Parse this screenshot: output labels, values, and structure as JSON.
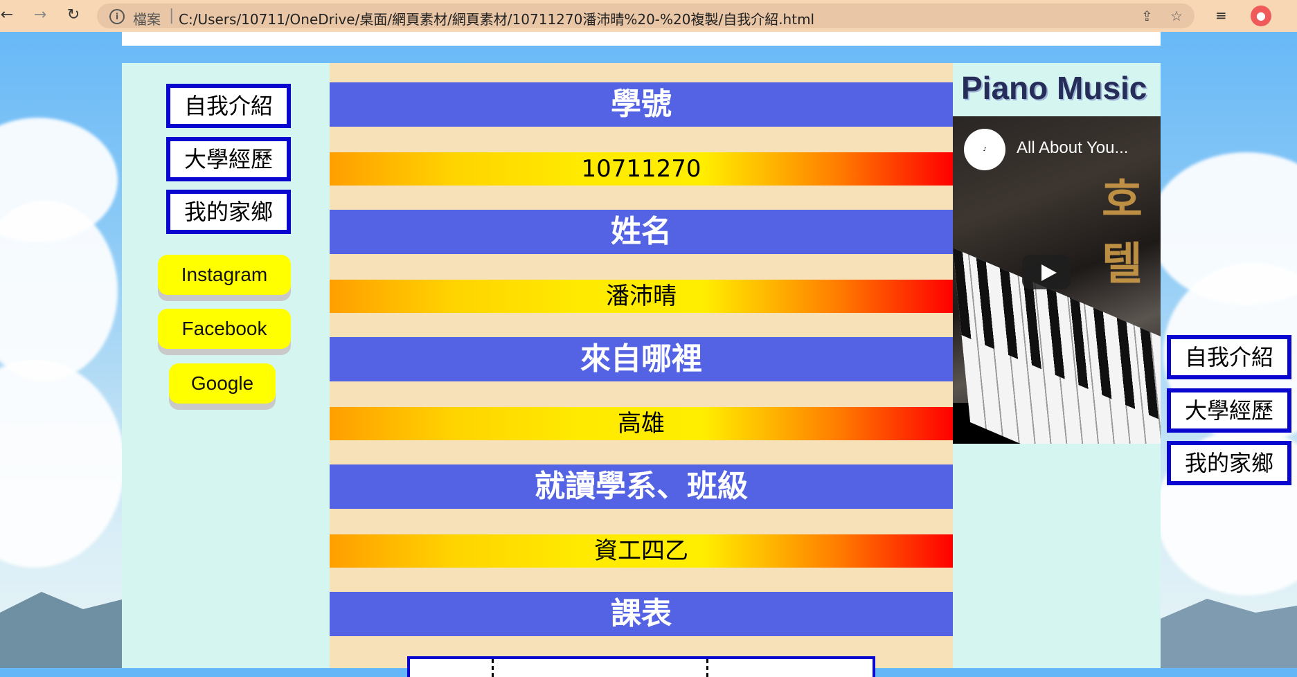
{
  "browser": {
    "address_label": "檔案",
    "url": "C:/Users/10711/OneDrive/桌面/網頁素材/網頁素材/10711270潘沛晴%20-%20複製/自我介紹.html"
  },
  "left_nav": [
    "自我介紹",
    "大學經歷",
    "我的家鄉"
  ],
  "links": [
    "Instagram",
    "Facebook",
    "Google"
  ],
  "sections": [
    {
      "heading": "學號",
      "value": "10711270"
    },
    {
      "heading": "姓名",
      "value": "潘沛晴"
    },
    {
      "heading": "來自哪裡",
      "value": "高雄"
    },
    {
      "heading": "就讀學系、班級",
      "value": "資工四乙"
    },
    {
      "heading": "課表",
      "value": ""
    }
  ],
  "sidebar": {
    "title": "Piano Music",
    "video_title": "All About You..."
  },
  "right_nav": [
    "自我介紹",
    "大學經歷",
    "我的家鄉"
  ]
}
